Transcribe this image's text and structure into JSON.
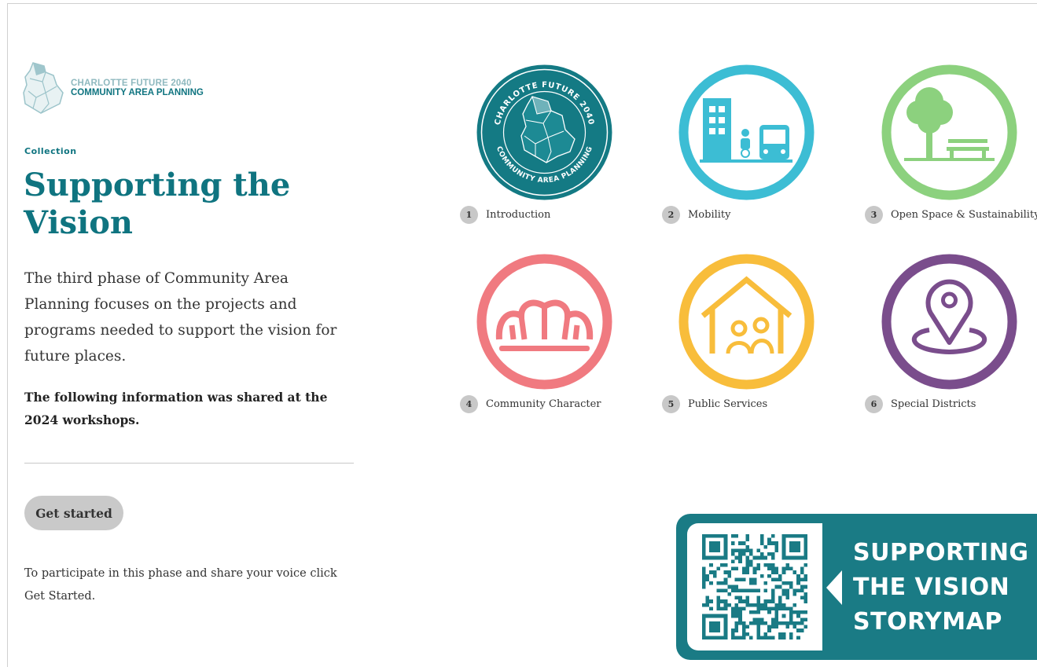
{
  "logo": {
    "line1": "CHARLOTTE FUTURE 2040",
    "line2": "COMMUNITY AREA PLANNING"
  },
  "collection_label": "Collection",
  "title": "Supporting the Vision",
  "description": "The third phase of Community Area Planning focuses on the projects and programs needed to support the vision for future places.",
  "workshop_note": "The following information was shared at the 2024 workshops.",
  "get_started_label": "Get started",
  "participate_text": "To participate in this phase and share your voice click Get Started.",
  "tiles": [
    {
      "number": "1",
      "label": "Introduction",
      "color": "#147a84",
      "icon": "charlotte-future-2040-seal-icon",
      "seal_top": "CHARLOTTE FUTURE 2040",
      "seal_bottom": "COMMUNITY AREA PLANNING"
    },
    {
      "number": "2",
      "label": "Mobility",
      "color": "#3cbdd4",
      "icon": "mobility-icon"
    },
    {
      "number": "3",
      "label": "Open Space & Sustainability",
      "color": "#8cd17e",
      "icon": "tree-bench-icon"
    },
    {
      "number": "4",
      "label": "Community Character",
      "color": "#f07a80",
      "icon": "crown-icon"
    },
    {
      "number": "5",
      "label": "Public Services",
      "color": "#f8bd3b",
      "icon": "house-people-icon"
    },
    {
      "number": "6",
      "label": "Special Districts",
      "color": "#7a4d8c",
      "icon": "location-pin-icon"
    }
  ],
  "storymap": {
    "lines": [
      "SUPPORTING",
      "THE VISION",
      "STORYMAP"
    ],
    "color": "#1a7b85"
  }
}
